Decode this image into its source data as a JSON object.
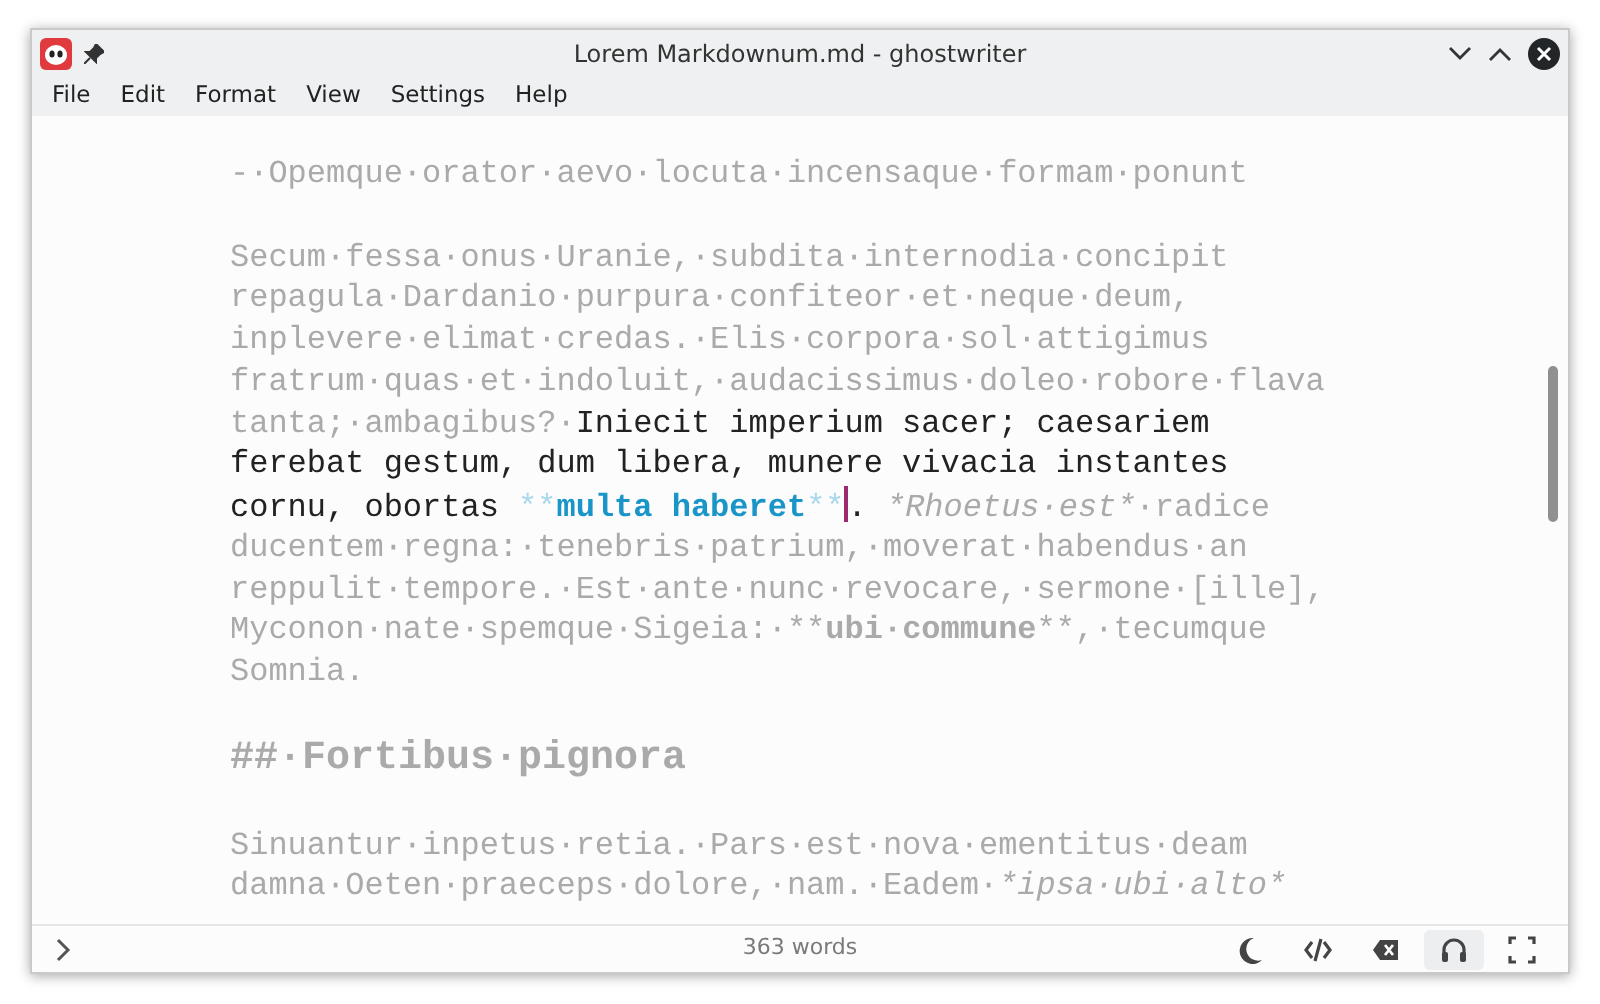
{
  "window": {
    "title": "Lorem Markdownum.md - ghostwriter"
  },
  "menu": [
    "File",
    "Edit",
    "Format",
    "View",
    "Settings",
    "Help"
  ],
  "editor": {
    "blocks": [
      {
        "kind": "paragraph",
        "lines": [
          [
            {
              "kind": "dim",
              "text": "-·Opemque·orator·aevo·locuta·incensaque·formam·ponunt"
            }
          ]
        ]
      },
      {
        "kind": "paragraph",
        "lines": [
          [
            {
              "kind": "dim",
              "text": "Secum·fessa·onus·Uranie,·subdita·internodia·concipit"
            }
          ],
          [
            {
              "kind": "dim",
              "text": "repagula·Dardanio·purpura·confiteor·et·neque·deum,"
            }
          ],
          [
            {
              "kind": "dim",
              "text": "inplevere·elimat·credas.·Elis·corpora·sol·attigimus"
            }
          ],
          [
            {
              "kind": "dim",
              "text": "fratrum·quas·et·indoluit,·audacissimus·doleo·robore·flava"
            }
          ],
          [
            {
              "kind": "dim",
              "text": "tanta;·ambagibus?·"
            },
            {
              "kind": "focus",
              "text": "Iniecit imperium sacer; caesariem"
            }
          ],
          [
            {
              "kind": "focus",
              "text": "ferebat gestum, dum libera, munere vivacia instantes"
            }
          ],
          [
            {
              "kind": "focus",
              "text": "cornu, obortas "
            },
            {
              "kind": "marker",
              "text": "**"
            },
            {
              "kind": "strong_focus",
              "text": "multa haberet"
            },
            {
              "kind": "marker",
              "text": "**"
            },
            {
              "kind": "caret"
            },
            {
              "kind": "focus",
              "text": ". "
            },
            {
              "kind": "emph",
              "text": "*Rhoetus·est*"
            },
            {
              "kind": "dim",
              "text": "·radice"
            }
          ],
          [
            {
              "kind": "dim",
              "text": "ducentem·regna:·tenebris·patrium,·moverat·habendus·an"
            }
          ],
          [
            {
              "kind": "dim",
              "text": "reppulit·tempore.·Est·ante·nunc·revocare,·sermone·[ille],"
            }
          ],
          [
            {
              "kind": "dim",
              "text": "Myconon·nate·spemque·Sigeia:·**"
            },
            {
              "kind": "strong",
              "text": "ubi·commune"
            },
            {
              "kind": "dim",
              "text": "**,·tecumque"
            }
          ],
          [
            {
              "kind": "dim",
              "text": "Somnia."
            }
          ]
        ]
      },
      {
        "kind": "heading",
        "lines": [
          [
            {
              "kind": "dim",
              "text": "##·Fortibus·pignora"
            }
          ]
        ]
      },
      {
        "kind": "paragraph",
        "lines": [
          [
            {
              "kind": "dim",
              "text": "Sinuantur·inpetus·retia.·Pars·est·nova·ementitus·deam"
            }
          ],
          [
            {
              "kind": "dim",
              "text": "damna·Oeten·praeceps·dolore,·nam.·Eadem·"
            },
            {
              "kind": "emph",
              "text": "*ipsa·ubi·alto*"
            }
          ]
        ]
      }
    ]
  },
  "status_bar": {
    "word_count": "363 words",
    "buttons": [
      {
        "kind": "moon",
        "on": false
      },
      {
        "kind": "code",
        "on": false
      },
      {
        "kind": "erase",
        "on": false
      },
      {
        "kind": "headphones",
        "on": true
      },
      {
        "kind": "fullscreen",
        "on": false
      }
    ]
  }
}
